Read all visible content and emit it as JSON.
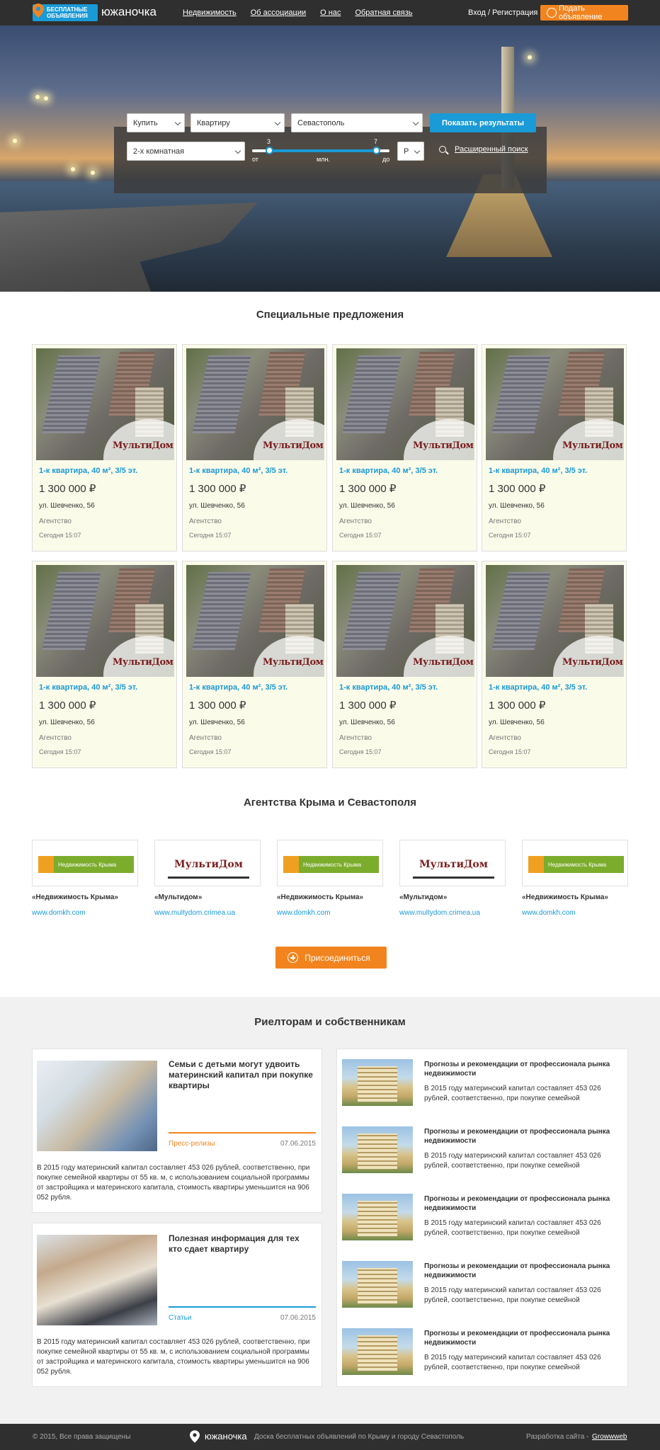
{
  "header": {
    "badge": "БЕСПЛАТНЫЕ ОБЪЯВЛЕНИЯ",
    "logo": "южаночка",
    "nav": [
      "Недвижимость",
      "Об ассоциации",
      "О нас",
      "Обратная связь"
    ],
    "login": "Вход / Регистрация",
    "post_button": "Подать объявление"
  },
  "search": {
    "deal": "Купить",
    "type": "Квартиру",
    "city": "Севастополь",
    "rooms": "2-х комнатная",
    "currency": "Р",
    "button": "Показать результаты",
    "price_from": "3",
    "price_to": "7",
    "from_label": "от",
    "to_label": "до",
    "unit": "млн.",
    "advanced": "Расширенный поиск"
  },
  "special": {
    "title": "Специальные предложения",
    "cards": [
      {
        "title": "1-к квартира, 40 м², 3/5 эт.",
        "price": "1 300 000 ₽",
        "address": "ул. Шевченко, 56",
        "agent": "Агентство",
        "date": "Сегодня 15:07",
        "brand": "МультиДом"
      },
      {
        "title": "1-к квартира, 40 м², 3/5 эт.",
        "price": "1 300 000 ₽",
        "address": "ул. Шевченко, 56",
        "agent": "Агентство",
        "date": "Сегодня 15:07",
        "brand": "МультиДом"
      },
      {
        "title": "1-к квартира, 40 м², 3/5 эт.",
        "price": "1 300 000 ₽",
        "address": "ул. Шевченко, 56",
        "agent": "Агентство",
        "date": "Сегодня 15:07",
        "brand": "МультиДом"
      },
      {
        "title": "1-к квартира, 40 м², 3/5 эт.",
        "price": "1 300 000 ₽",
        "address": "ул. Шевченко, 56",
        "agent": "Агентство",
        "date": "Сегодня 15:07",
        "brand": "МультиДом"
      },
      {
        "title": "1-к квартира, 40 м², 3/5 эт.",
        "price": "1 300 000 ₽",
        "address": "ул. Шевченко, 56",
        "agent": "Агентство",
        "date": "Сегодня 15:07",
        "brand": "МультиДом"
      },
      {
        "title": "1-к квартира, 40 м², 3/5 эт.",
        "price": "1 300 000 ₽",
        "address": "ул. Шевченко, 56",
        "agent": "Агентство",
        "date": "Сегодня 15:07",
        "brand": "МультиДом"
      },
      {
        "title": "1-к квартира, 40 м², 3/5 эт.",
        "price": "1 300 000 ₽",
        "address": "ул. Шевченко, 56",
        "agent": "Агентство",
        "date": "Сегодня 15:07",
        "brand": "МультиДом"
      },
      {
        "title": "1-к квартира, 40 м², 3/5 эт.",
        "price": "1 300 000 ₽",
        "address": "ул. Шевченко, 56",
        "agent": "Агентство",
        "date": "Сегодня 15:07",
        "brand": "МультиДом"
      }
    ]
  },
  "agencies": {
    "title": "Агентства Крыма и Севастополя",
    "items": [
      {
        "name": "«Недвижимость Крыма»",
        "url": "www.domkh.com",
        "logo": "Недвижимость Крыма",
        "style": "green"
      },
      {
        "name": "«Мультидом»",
        "url": "www.multydom.crimea.ua",
        "logo": "МультиДом",
        "style": "m"
      },
      {
        "name": "«Недвижимость Крыма»",
        "url": "www.domkh.com",
        "logo": "Недвижимость Крыма",
        "style": "green"
      },
      {
        "name": "«Мультидом»",
        "url": "www.multydom.crimea.ua",
        "logo": "МультиДом",
        "style": "m"
      },
      {
        "name": "«Недвижимость Крыма»",
        "url": "www.domkh.com",
        "logo": "Недвижимость Крыма",
        "style": "green"
      }
    ],
    "join_button": "Присоединиться"
  },
  "realtors": {
    "title": "Риелторам и собственникам",
    "main": [
      {
        "title": "Семьи с детьми могут удвоить материнский капитал при покупке квартиры",
        "category": "Пресс-релизы",
        "date": "07.06.2015",
        "text": "В 2015 году материнский капитал составляет 453 026 рублей, соответственно, при покупке семейной квартиры от 55 кв. м, с использованием социальной программы от застройщика и материнского капитала, стоимость квартиры уменьшится на 906 052 рубля.",
        "accent": "#f2841f"
      },
      {
        "title": "Полезная информация для тех кто сдает квартиру",
        "category": "Статьи",
        "date": "07.06.2015",
        "text": "В 2015 году материнский капитал составляет 453 026 рублей, соответственно, при покупке семейной квартиры от 55 кв. м, с использованием социальной программы от застройщика и материнского капитала, стоимость квартиры уменьшится на 906 052 рубля.",
        "accent": "#1a9ad6"
      }
    ],
    "side": [
      {
        "title": "Прогнозы и рекомендации от профессионала рынка недвижимости",
        "text": "В 2015 году материнский капитал составляет 453 026 рублей, соответственно, при покупке семейной"
      },
      {
        "title": "Прогнозы и рекомендации от профессионала рынка недвижимости",
        "text": "В 2015 году материнский капитал составляет 453 026 рублей, соответственно, при покупке семейной"
      },
      {
        "title": "Прогнозы и рекомендации от профессионала рынка недвижимости",
        "text": "В 2015 году материнский капитал составляет 453 026 рублей, соответственно, при покупке семейной"
      },
      {
        "title": "Прогнозы и рекомендации от профессионала рынка недвижимости",
        "text": "В 2015 году материнский капитал составляет 453 026 рублей, соответственно, при покупке семейной"
      },
      {
        "title": "Прогнозы и рекомендации от профессионала рынка недвижимости",
        "text": "В 2015 году материнский капитал составляет 453 026 рублей, соответственно, при покупке семейной"
      }
    ]
  },
  "footer": {
    "copyright": "© 2015, Все права защищены",
    "logo": "южаночка",
    "tagline": "Доска бесплатных объявлений по Крыму и городу Севастополь",
    "dev_label": "Разработка сайта -",
    "dev_link": "Growwweb"
  }
}
